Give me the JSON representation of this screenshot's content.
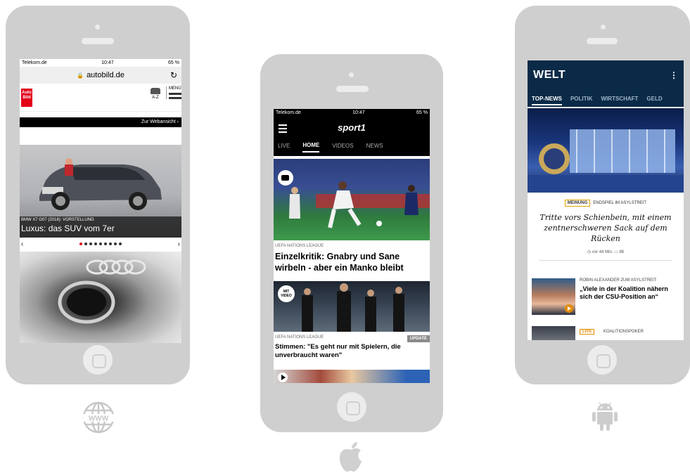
{
  "phones": {
    "web": {
      "status": {
        "carrier": "Telekom.de",
        "time": "10:47",
        "battery": "65 %"
      },
      "url": "autobild.de",
      "logo_text": "Auto Bild",
      "az_label": "A-Z",
      "menu_label": "MENÜ",
      "webansicht_label": "Zur Webansicht",
      "hero": {
        "caption_small": "BMW X7 G07 (2018): VORSTELLUNG",
        "caption_big": "Luxus: das SUV vom 7er"
      },
      "slider_dots_total": 9,
      "slider_dot_active": 1
    },
    "ios": {
      "status": {
        "carrier": "Telekom.de",
        "time": "10:47",
        "battery": "65 %"
      },
      "logo": "sport1",
      "tabs": [
        {
          "label": "LIVE",
          "active": false
        },
        {
          "label": "HOME",
          "active": true
        },
        {
          "label": "VIDEOS",
          "active": false
        },
        {
          "label": "NEWS",
          "active": false
        }
      ],
      "articles": [
        {
          "kicker": "UEFA NATIONS LEAGUE",
          "headline": "Einzelkritik: Gnabry und Sane wirbeln - aber ein Manko bleibt"
        },
        {
          "kicker": "UEFA NATIONS LEAGUE",
          "headline": "Stimmen: \"Es geht nur mit Spielern, die unverbraucht waren\"",
          "badge": "UPDATE",
          "video_badge": "MIT VIDEO"
        }
      ]
    },
    "android": {
      "logo": "WELT",
      "tabs": [
        {
          "label": "TOP-NEWS",
          "active": true
        },
        {
          "label": "POLITIK",
          "active": false
        },
        {
          "label": "WIRTSCHAFT",
          "active": false
        },
        {
          "label": "GELD",
          "active": false
        }
      ],
      "lead": {
        "badge": "MEINUNG",
        "kicker": "ENDSPIEL IM ASYLSTREIT",
        "headline": "Tritte vors Schienbein, mit einem zentnerschweren Sack auf dem Rücken",
        "time": "vor 44 Min.",
        "comments": "88"
      },
      "second": {
        "kicker": "ROBIN ALEXANDER ZUM ASYLSTREIT",
        "headline": "„Viele in der Koalition nähern sich der CSU-Position an“"
      },
      "third": {
        "badge": "LIVE",
        "kicker": "KOALITIONSPOKER"
      }
    }
  },
  "icons": {
    "web": "www-globe-icon",
    "ios": "apple-icon",
    "android": "android-icon"
  },
  "colors": {
    "phone_body": "#cfcfcf",
    "autobild_red": "#e2001a",
    "welt_navy": "#0a2a48",
    "welt_accent": "#e38b00"
  }
}
